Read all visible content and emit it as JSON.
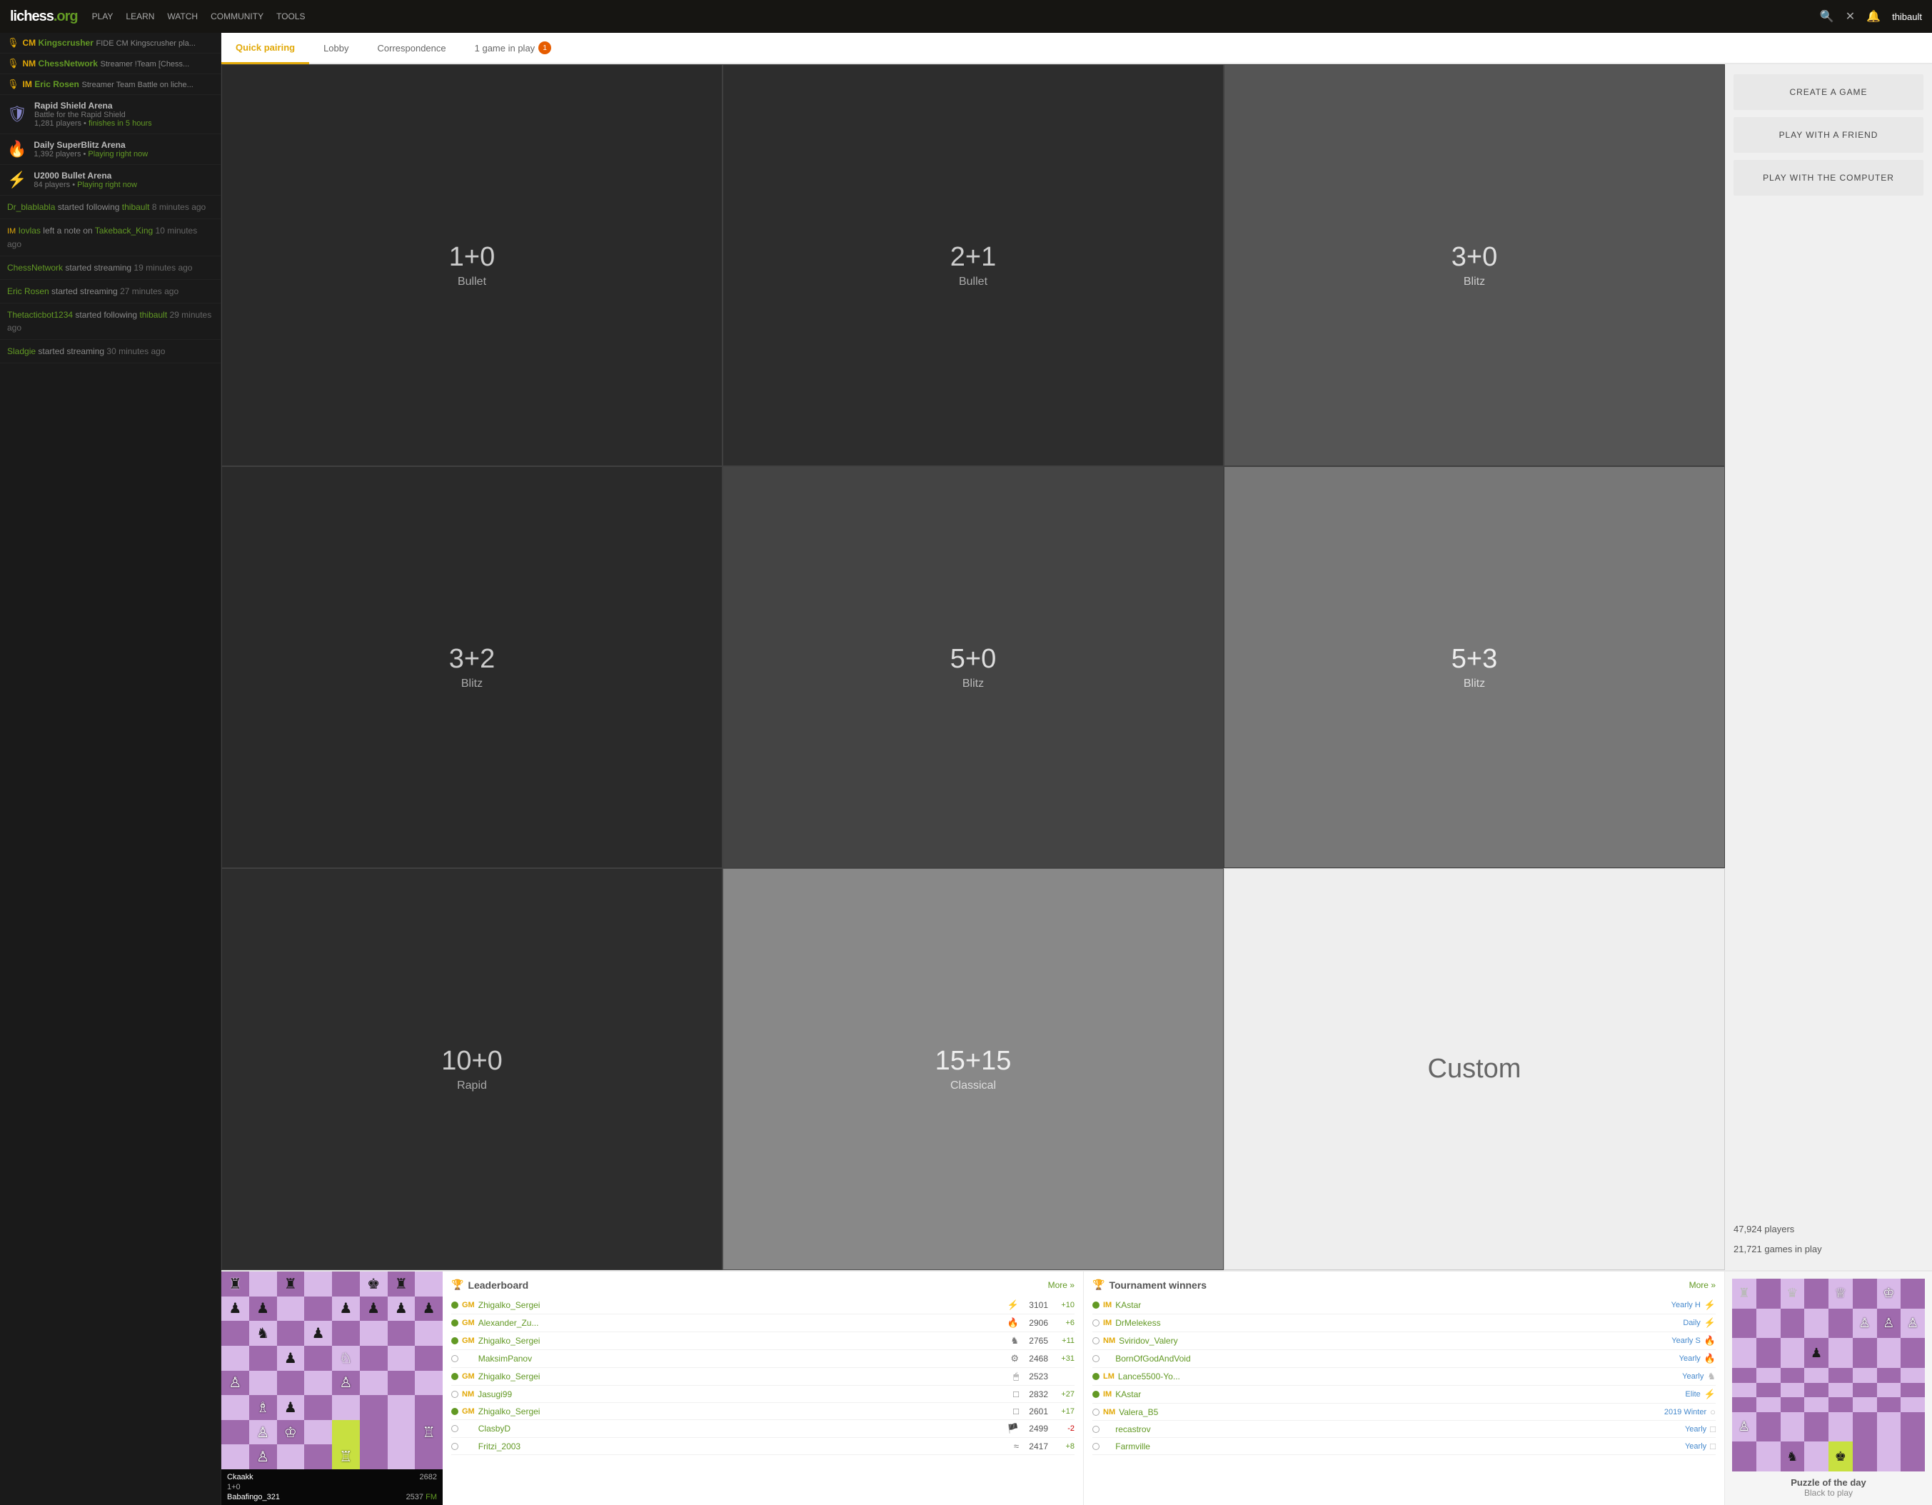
{
  "nav": {
    "logo": "lichess",
    "logo_tld": ".org",
    "links": [
      "PLAY",
      "LEARN",
      "WATCH",
      "COMMUNITY",
      "TOOLS"
    ],
    "user": "thibault"
  },
  "tabs": [
    {
      "id": "quick-pairing",
      "label": "Quick pairing",
      "active": true
    },
    {
      "id": "lobby",
      "label": "Lobby",
      "active": false
    },
    {
      "id": "correspondence",
      "label": "Correspondence",
      "active": false
    },
    {
      "id": "game-in-play",
      "label": "1 game in play",
      "badge": "1",
      "active": false
    }
  ],
  "pairing_cells": [
    {
      "time": "1+0",
      "mode": "Bullet"
    },
    {
      "time": "2+1",
      "mode": "Bullet"
    },
    {
      "time": "3+0",
      "mode": "Blitz"
    },
    {
      "time": "3+2",
      "mode": "Blitz"
    },
    {
      "time": "5+0",
      "mode": "Blitz"
    },
    {
      "time": "5+3",
      "mode": "Blitz"
    },
    {
      "time": "10+0",
      "mode": "Rapid"
    },
    {
      "time": "15+15",
      "mode": "Classical"
    },
    {
      "time": "Custom",
      "mode": ""
    }
  ],
  "right_panel": {
    "create_game": "CREATE A GAME",
    "play_friend": "PLAY WITH A FRIEND",
    "play_computer": "PLAY WITH THE COMPUTER",
    "players_count": "47,924 players",
    "games_count": "21,721 games in play"
  },
  "streamers": [
    {
      "title": "CM",
      "name": "Kingscrusher",
      "desc": "FIDE CM Kingscrusher pla..."
    },
    {
      "title": "NM",
      "name": "ChessNetwork",
      "desc": "Streamer !Team [Chess..."
    },
    {
      "title": "IM",
      "name": "Eric Rosen",
      "desc": "Streamer Team Battle on liche..."
    }
  ],
  "tournaments": [
    {
      "icon": "shield",
      "name": "Rapid Shield Arena",
      "sub1": "Battle for the Rapid Shield",
      "sub2": "1,281 players",
      "sub3": "finishes in 5 hours"
    },
    {
      "icon": "fire",
      "name": "Daily SuperBlitz Arena",
      "sub1": "1,392 players",
      "sub2": "Playing right now"
    },
    {
      "icon": "bolt",
      "name": "U2000 Bullet Arena",
      "sub1": "84 players",
      "sub2": "Playing right now"
    }
  ],
  "activity": [
    {
      "text": "Dr_blablabla started following thibault",
      "time": "8 minutes ago"
    },
    {
      "text": "IM Iovlas left a note on Takeback_King",
      "time": "10 minutes ago"
    },
    {
      "text": "ChessNetwork started streaming",
      "time": "19 minutes ago"
    },
    {
      "text": "Eric Rosen started streaming",
      "time": "27 minutes ago"
    },
    {
      "text": "Thetacticbot1234 started following thibault",
      "time": "29 minutes ago"
    },
    {
      "text": "Sladgie started streaming",
      "time": "30 minutes ago"
    }
  ],
  "leaderboard": {
    "title": "Leaderboard",
    "more": "More »",
    "rows": [
      {
        "title": "GM",
        "name": "Zhigalko_Sergei",
        "mode": "⚡",
        "rating": "3101",
        "progress": "+10",
        "online": true
      },
      {
        "title": "GM",
        "name": "Alexander_Zu...",
        "mode": "🔥",
        "rating": "2906",
        "progress": "+6",
        "online": true
      },
      {
        "title": "GM",
        "name": "Zhigalko_Sergei",
        "mode": "♞",
        "rating": "2765",
        "progress": "+11",
        "online": true
      },
      {
        "title": "",
        "name": "MaksimPanov",
        "mode": "⚙",
        "rating": "2468",
        "progress": "+31",
        "online": false
      },
      {
        "title": "GM",
        "name": "Zhigalko_Sergei",
        "mode": "🖱",
        "rating": "2523",
        "progress": "",
        "online": true
      },
      {
        "title": "NM",
        "name": "Jasugi99",
        "mode": "□",
        "rating": "2832",
        "progress": "+27",
        "online": false
      },
      {
        "title": "GM",
        "name": "Zhigalko_Sergei",
        "mode": "□",
        "rating": "2601",
        "progress": "+17",
        "online": true
      },
      {
        "title": "",
        "name": "ClasbyD",
        "mode": "🏴",
        "rating": "2499",
        "progress": "-2",
        "online": false,
        "negative": true
      },
      {
        "title": "",
        "name": "Fritzi_2003",
        "mode": "≈",
        "rating": "2417",
        "progress": "+8",
        "online": false
      }
    ]
  },
  "tournament_winners": {
    "title": "Tournament winners",
    "more": "More »",
    "rows": [
      {
        "title": "IM",
        "name": "KAstar",
        "tourney": "Yearly H",
        "icon": "⚡",
        "online": true
      },
      {
        "title": "IM",
        "name": "DrMelekess",
        "tourney": "Daily",
        "icon": "⚡",
        "online": false
      },
      {
        "title": "NM",
        "name": "Sviridov_Valery",
        "tourney": "Yearly S",
        "icon": "🔥",
        "online": false
      },
      {
        "title": "",
        "name": "BornOfGodAndVoid",
        "tourney": "Yearly",
        "icon": "🔥",
        "online": false
      },
      {
        "title": "LM",
        "name": "Lance5500-Yo...",
        "tourney": "Yearly",
        "icon": "♞",
        "online": true
      },
      {
        "title": "IM",
        "name": "KAstar",
        "tourney": "Elite",
        "icon": "⚡",
        "online": true
      },
      {
        "title": "NM",
        "name": "Valera_B5",
        "tourney": "2019 Winter",
        "icon": "○",
        "online": false
      },
      {
        "title": "",
        "name": "recastrov",
        "tourney": "Yearly",
        "icon": "□",
        "online": false
      },
      {
        "title": "",
        "name": "Farmville",
        "tourney": "Yearly",
        "icon": "□",
        "online": false
      }
    ]
  },
  "bottom_board": {
    "player1": "Ckaakk",
    "player1_rating": "2682",
    "time_control": "1+0",
    "player2": "Babafingo_321",
    "player2_rating": "2537",
    "player2_title": "FM"
  },
  "puzzle": {
    "label": "Puzzle of the day",
    "sub": "Black to play"
  }
}
